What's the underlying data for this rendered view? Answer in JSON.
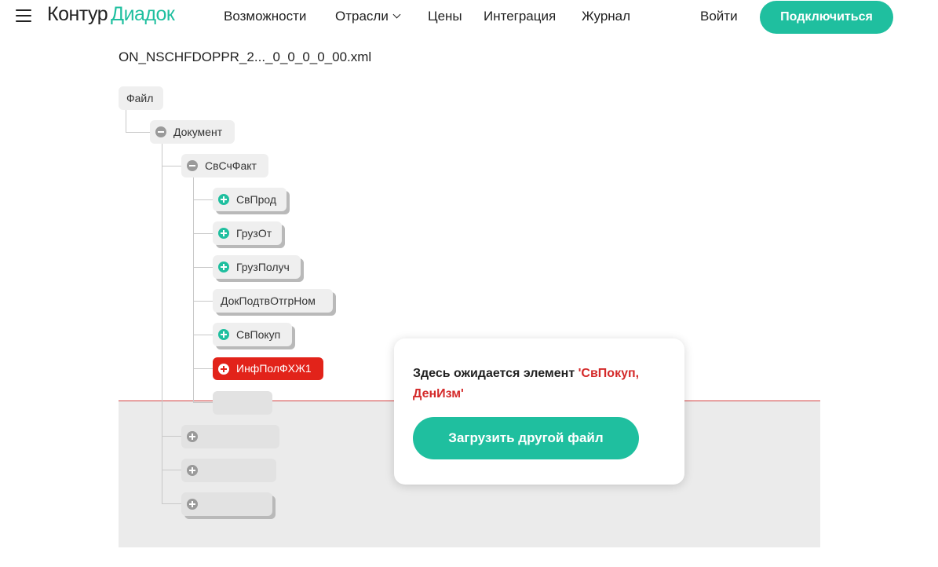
{
  "header": {
    "menu_icon": "hamburger-menu-icon",
    "logo_part1": "Контур",
    "logo_part2": "Диадок",
    "nav": {
      "features": "Возможности",
      "industries": "Отрасли",
      "prices": "Цены",
      "integration": "Интеграция",
      "journal": "Журнал"
    },
    "login": "Войти",
    "connect": "Подключиться"
  },
  "file": {
    "name": "ON_NSCHFDOPPR_2..._0_0_0_0_00.xml"
  },
  "tree": {
    "root": "Файл",
    "document": "Документ",
    "invoice": "СвСчФакт",
    "seller": "СвПрод",
    "shipper": "ГрузОт",
    "consignee": "ГрузПолуч",
    "shipping_doc": "ДокПодтвОтгрНом",
    "buyer": "СвПокуп",
    "info_field": "ИнфПолФХЖ1"
  },
  "popup": {
    "message_prefix": "Здесь ожидается элемент ",
    "message_required": "'СвПокуп, ДенИзм'",
    "button": "Загрузить другой файл"
  },
  "colors": {
    "brand": "#1fbf9f",
    "error": "#e2231a",
    "text": "#222222"
  }
}
